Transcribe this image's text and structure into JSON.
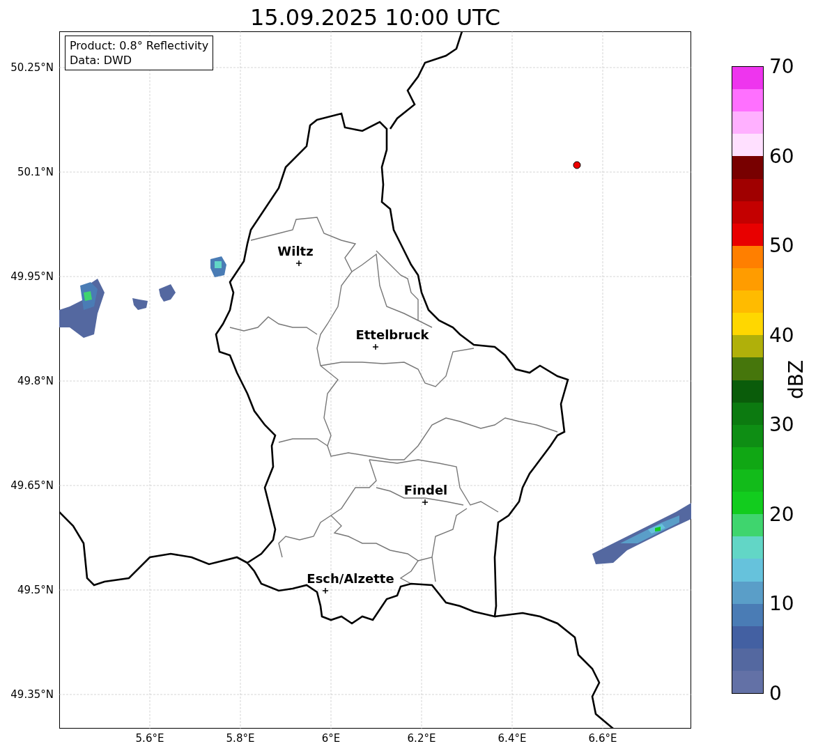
{
  "title": "15.09.2025 10:00 UTC",
  "info_box": {
    "lines": [
      "Product: 0.8° Reflectivity",
      "Data: DWD"
    ]
  },
  "map": {
    "y_ticks": [
      "50.25°N",
      "50.1°N",
      "49.95°N",
      "49.8°N",
      "49.65°N",
      "49.5°N",
      "49.35°N"
    ],
    "x_ticks": [
      "5.6°E",
      "5.8°E",
      "6°E",
      "6.2°E",
      "6.4°E",
      "6.6°E"
    ],
    "cities": [
      {
        "name": "Wiltz"
      },
      {
        "name": "Ettelbruck"
      },
      {
        "name": "Findel"
      },
      {
        "name": "Esch/Alzette"
      }
    ]
  },
  "colorbar": {
    "label": "dBZ",
    "ticks": [
      "70",
      "60",
      "50",
      "40",
      "30",
      "20",
      "10",
      "0"
    ],
    "bands": [
      {
        "color": "#ee35ee"
      },
      {
        "color": "#ff70ff"
      },
      {
        "color": "#ffb0ff"
      },
      {
        "color": "#ffe0ff"
      },
      {
        "color": "#780000"
      },
      {
        "color": "#a00000"
      },
      {
        "color": "#c40000"
      },
      {
        "color": "#e80000"
      },
      {
        "color": "#ff7f00"
      },
      {
        "color": "#ff9c00"
      },
      {
        "color": "#ffbb00"
      },
      {
        "color": "#ffd700"
      },
      {
        "color": "#b0b00a"
      },
      {
        "color": "#46760c"
      },
      {
        "color": "#0a5c0a"
      },
      {
        "color": "#0c7a10"
      },
      {
        "color": "#0e8e14"
      },
      {
        "color": "#10a714"
      },
      {
        "color": "#12bb1a"
      },
      {
        "color": "#12cc1e"
      },
      {
        "color": "#3fd56e"
      },
      {
        "color": "#62d6c6"
      },
      {
        "color": "#66c2dc"
      },
      {
        "color": "#5a9ec8"
      },
      {
        "color": "#4a7cb5"
      },
      {
        "color": "#4360a2"
      },
      {
        "color": "#5468a0"
      },
      {
        "color": "#6371a6"
      }
    ]
  }
}
